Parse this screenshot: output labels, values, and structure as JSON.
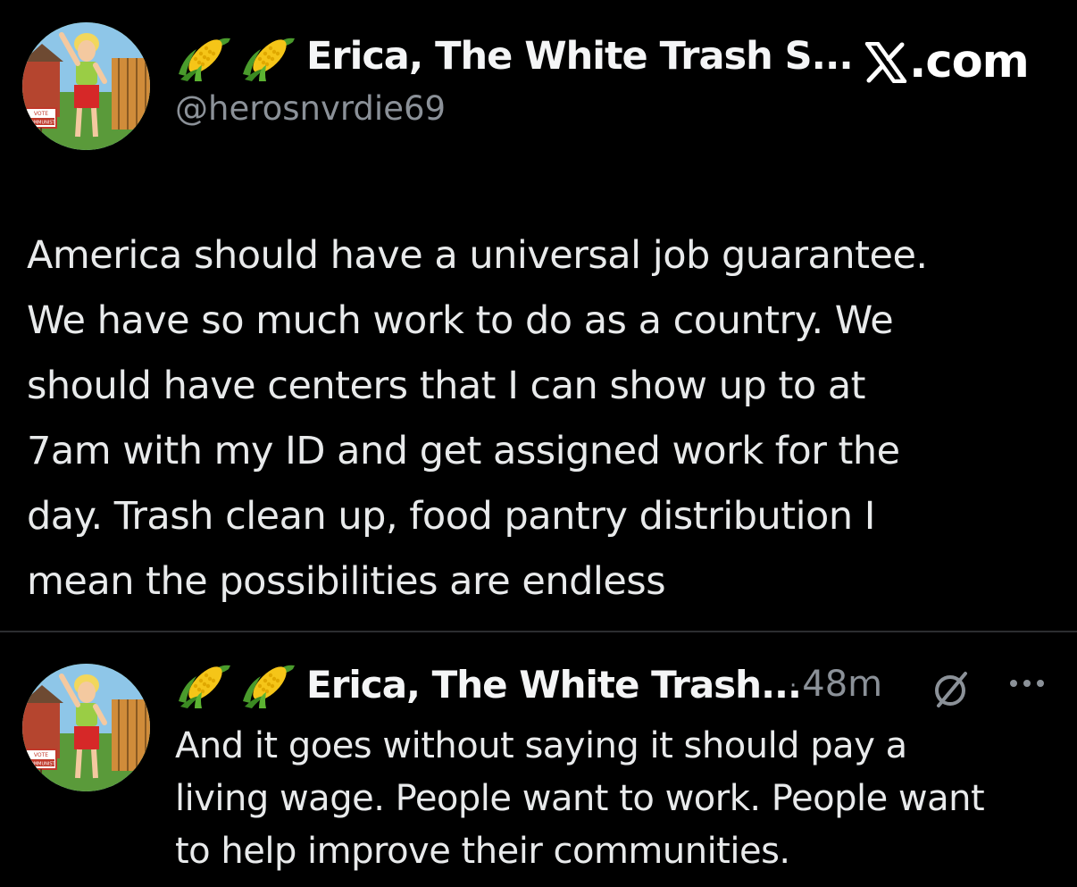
{
  "brand": {
    "site_label": ".com",
    "logo_icon": "x-logo-icon"
  },
  "main_tweet": {
    "emoji": [
      "corn-emoji",
      "corn-emoji"
    ],
    "display_name": "Erica, The White Trash S...",
    "handle": "@herosnvrdie69",
    "avatar_icon": "cartoon-avatar",
    "avatar_sign_text": [
      "VOTE",
      "COMMUNIST"
    ],
    "lines": [
      "America should have a universal job guarantee.",
      "We have so much work to do as a country. We",
      "should have centers that I can show up to at",
      "7am with my ID and get assigned work for the",
      "day. Trash clean up, food pantry distribution I",
      "mean the possibilities are endless"
    ]
  },
  "reply_tweet": {
    "emoji": [
      "corn-emoji",
      "corn-emoji"
    ],
    "display_name": "Erica, The White Trash...",
    "separator": "·",
    "timestamp": "48m",
    "grok_icon": "grok-icon",
    "more_icon": "more-dots-icon",
    "avatar_sign_text": [
      "VOTE",
      "COMMUNIST"
    ],
    "lines": [
      "And it goes without saying it should pay a",
      "living wage. People want to work. People want",
      "to help improve their communities."
    ]
  },
  "colors": {
    "background": "#000000",
    "text": "#e8eaeb",
    "muted": "#8b9198",
    "divider": "#2b2d30"
  }
}
